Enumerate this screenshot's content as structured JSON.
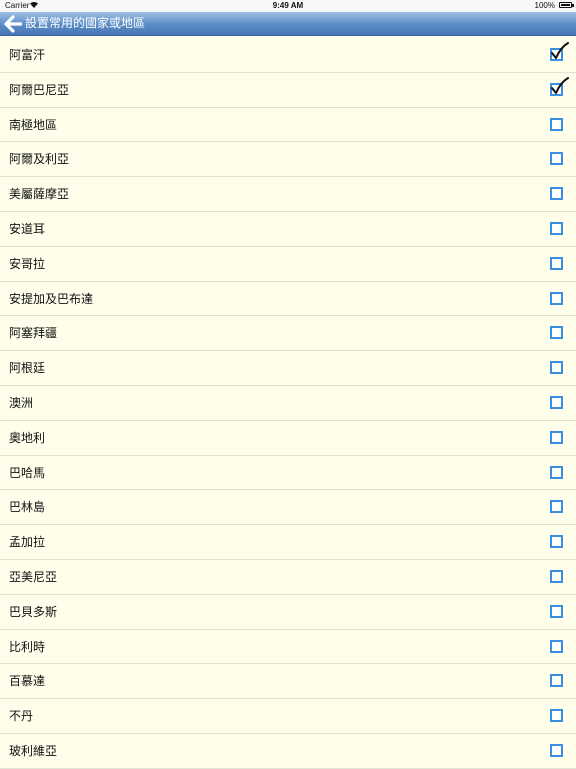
{
  "status_bar": {
    "carrier": "Carrier",
    "time": "9:49 AM",
    "battery": "100%"
  },
  "nav": {
    "title": "設置常用的國家或地區"
  },
  "colors": {
    "background": "#fefeeb",
    "nav_gradient_top": "#9fbfe3",
    "nav_gradient_bottom": "#4677b5",
    "checkbox_border": "#3b8fe0"
  },
  "countries": [
    {
      "name": "阿富汗",
      "checked": true
    },
    {
      "name": "阿爾巴尼亞",
      "checked": true
    },
    {
      "name": "南極地區",
      "checked": false
    },
    {
      "name": "阿爾及利亞",
      "checked": false
    },
    {
      "name": "美屬薩摩亞",
      "checked": false
    },
    {
      "name": "安道耳",
      "checked": false
    },
    {
      "name": "安哥拉",
      "checked": false
    },
    {
      "name": "安提加及巴布達",
      "checked": false
    },
    {
      "name": "阿塞拜疆",
      "checked": false
    },
    {
      "name": "阿根廷",
      "checked": false
    },
    {
      "name": "澳洲",
      "checked": false
    },
    {
      "name": "奧地利",
      "checked": false
    },
    {
      "name": "巴哈馬",
      "checked": false
    },
    {
      "name": "巴林島",
      "checked": false
    },
    {
      "name": "孟加拉",
      "checked": false
    },
    {
      "name": "亞美尼亞",
      "checked": false
    },
    {
      "name": "巴貝多斯",
      "checked": false
    },
    {
      "name": "比利時",
      "checked": false
    },
    {
      "name": "百慕達",
      "checked": false
    },
    {
      "name": "不丹",
      "checked": false
    },
    {
      "name": "玻利維亞",
      "checked": false
    }
  ]
}
